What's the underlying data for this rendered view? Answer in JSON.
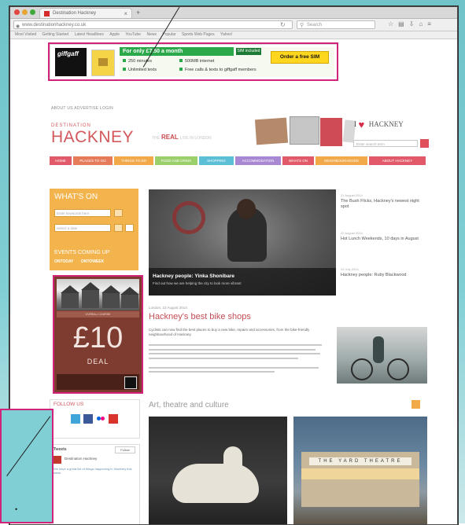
{
  "browser": {
    "tab_title": "Destination Hackney",
    "url": "www.destinationhackney.co.uk",
    "search_placeholder": "Search",
    "bookmarks": [
      "Most Visited",
      "Getting Started",
      "Latest Headlines",
      "Apple",
      "YouTube",
      "News",
      "Popular",
      "Sports Web Pages",
      "Yahoo!"
    ]
  },
  "ad": {
    "brand": "giffgaff",
    "headline": "For only £7.50 a month",
    "tag": "SIM included",
    "features": [
      "250 minutes",
      "Unlimited texts",
      "500MB internet",
      "Free calls & texts to giffgaff members"
    ],
    "cta": "Order a free SIM"
  },
  "header": {
    "top_links": "ABOUT US   ADVERTISE   LOGIN",
    "brand_small": "DESTINATION",
    "brand_big": "HACKNEY",
    "tagline": "REAL",
    "tagline_small": "LIVE IN LONDON",
    "love_prefix": "I",
    "love_place": "HACKNEY",
    "search_placeholder": "Enter search term"
  },
  "nav": [
    {
      "label": "HOME",
      "color": "#e25a69"
    },
    {
      "label": "PLACES TO GO",
      "color": "#e67b5a"
    },
    {
      "label": "THINGS TO DO",
      "color": "#f1a94a"
    },
    {
      "label": "FOOD AND DRINK",
      "color": "#9bcf6a"
    },
    {
      "label": "SHOPPING",
      "color": "#5cbfd6"
    },
    {
      "label": "ACCOMMODATION",
      "color": "#a887d3"
    },
    {
      "label": "WHATS ON",
      "color": "#e25a69"
    },
    {
      "label": "NEIGHBOURHOODS",
      "color": "#f1a94a"
    },
    {
      "label": "ABOUT HACKNEY",
      "color": "#e25a69"
    }
  ],
  "whatson": {
    "title": "WHAT'S ON",
    "input1": "Enter keywords here",
    "input2": "Select a date",
    "events_title": "EVENTS COMING UP",
    "link1": "ONTODAY",
    "link2": "ONTOWEEK"
  },
  "side_ad": {
    "strip": "OVERALL COURSE",
    "price": "£10",
    "deal": "DEAL"
  },
  "follow": {
    "title": "FOLLOW US"
  },
  "tweets": {
    "title": "Tweets",
    "follow_button": "Follow",
    "account": "Destination Hackney",
    "text": "We have a great list of things happening in Hackney this week."
  },
  "hero": {
    "caption_title": "Hackney people: Yinka Shonibare",
    "caption_sub": "Find out how we are helping the city to look more vibrant"
  },
  "hero_list": [
    {
      "date": "21 August 2014",
      "title": "The Bush Flicks, Hackney's newest night spot"
    },
    {
      "date": "22 August 2014",
      "title": "Hot Lunch Weekends, 10 days in August"
    },
    {
      "date": "20 July 2014",
      "title": "Hackney people: Ruby Blackwood"
    }
  ],
  "article": {
    "meta": "London, 22 August 2014",
    "title": "Hackney's best bike shops",
    "lead": "Cyclists can now find the best places to buy a new bike, repairs and accessories, from the bike-friendly neighbourhood of Hackney."
  },
  "section": {
    "title": "Art, theatre and culture",
    "theatre_sign": "THE YARD THEATRE"
  },
  "colors": {
    "accent_pink": "#d2237a",
    "brand_red": "#d2585c",
    "whatson_orange": "#f3b44d",
    "ad_green": "#2aa84a"
  },
  "icons": [
    "back-icon",
    "search-icon",
    "reload-icon",
    "heart-icon",
    "twitter-icon",
    "facebook-icon",
    "flickr-icon",
    "youtube-icon",
    "calendar-icon",
    "grid-icon"
  ]
}
